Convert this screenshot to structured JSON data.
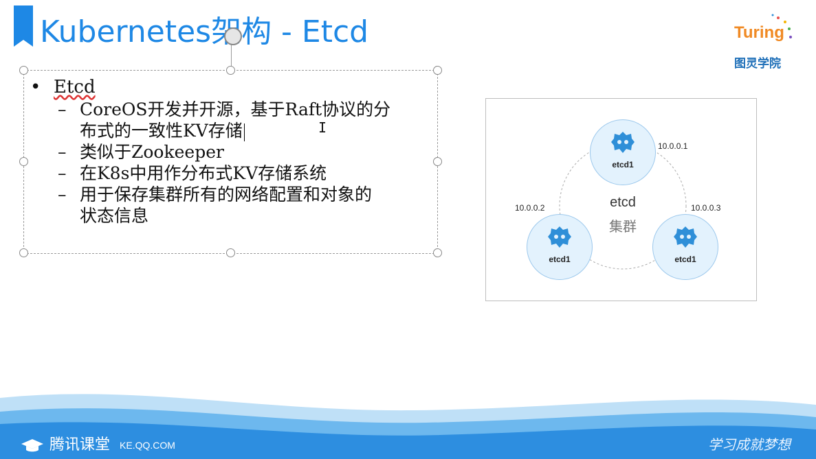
{
  "slide": {
    "title": "Kubernetes架构 - Etcd",
    "bullet_main": "Etcd",
    "sub_bullets": [
      "CoreOS开发并开源，基于Raft协议的分布式的一致性KV存储",
      "类似于Zookeeper",
      "在K8s中用作分布式KV存储系统",
      "用于保存集群所有的网络配置和对象的状态信息"
    ],
    "sub_bullet_1_line1": "CoreOS开发并开源，基于Raft协议的分",
    "sub_bullet_1_line2": "布式的一致性KV存储",
    "sub_bullet_4_line1": "用于保存集群所有的网络配置和对象的",
    "sub_bullet_4_line2": "状态信息",
    "dash": "–",
    "dot": "•"
  },
  "diagram": {
    "cluster_name": "etcd",
    "cluster_sub": "集群",
    "nodes": [
      {
        "label": "etcd1",
        "ip": "10.0.0.1"
      },
      {
        "label": "etcd1",
        "ip": "10.0.0.2"
      },
      {
        "label": "etcd1",
        "ip": "10.0.0.3"
      }
    ],
    "node_color": "#e3f2fd",
    "icon_color": "#2f8fd8"
  },
  "logo": {
    "top_text": "Turing",
    "bottom_text": "图灵学院"
  },
  "footer": {
    "brand": "腾讯课堂",
    "url": "KE.QQ.COM",
    "slogan": "学习成就梦想"
  },
  "colors": {
    "title": "#1e88e5",
    "footer_wave": "#2d8ee0"
  }
}
